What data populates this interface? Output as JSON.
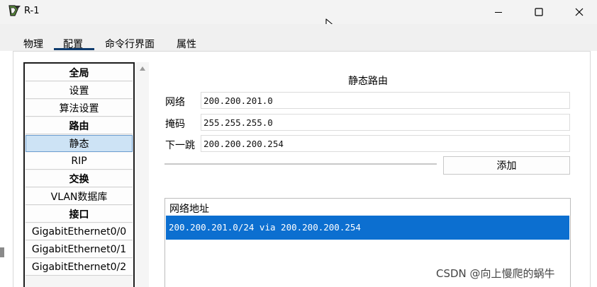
{
  "window": {
    "title": "R-1",
    "controls": {
      "minimize": "minimize-icon",
      "maximize": "maximize-icon",
      "close": "close-icon"
    }
  },
  "tabs": [
    {
      "label": "物理",
      "active": false
    },
    {
      "label": "配置",
      "active": true
    },
    {
      "label": "命令行界面",
      "active": false
    },
    {
      "label": "属性",
      "active": false
    }
  ],
  "nav": {
    "items": [
      {
        "label": "全局",
        "heading": true
      },
      {
        "label": "设置",
        "heading": false
      },
      {
        "label": "算法设置",
        "heading": false
      },
      {
        "label": "路由",
        "heading": true
      },
      {
        "label": "静态",
        "heading": false,
        "selected": true
      },
      {
        "label": "RIP",
        "heading": false
      },
      {
        "label": "交换",
        "heading": true
      },
      {
        "label": "VLAN数据库",
        "heading": false
      },
      {
        "label": "接口",
        "heading": true
      },
      {
        "label": "GigabitEthernet0/0",
        "heading": false
      },
      {
        "label": "GigabitEthernet0/1",
        "heading": false
      },
      {
        "label": "GigabitEthernet0/2",
        "heading": false
      }
    ]
  },
  "static_route": {
    "title": "静态路由",
    "network_label": "网络",
    "network_value": "200.200.201.0",
    "mask_label": "掩码",
    "mask_value": "255.255.255.0",
    "next_hop_label": "下一跳",
    "next_hop_value": "200.200.200.254",
    "add_button": "添加"
  },
  "route_table": {
    "header": "网络地址",
    "rows": [
      "200.200.201.0/24 via 200.200.200.254"
    ]
  },
  "watermark": "CSDN @向上慢爬的蜗牛",
  "colors": {
    "selection": "#0c6fd0",
    "nav_selected": "#cde3f5",
    "tab_underline": "#0f3b6e"
  }
}
